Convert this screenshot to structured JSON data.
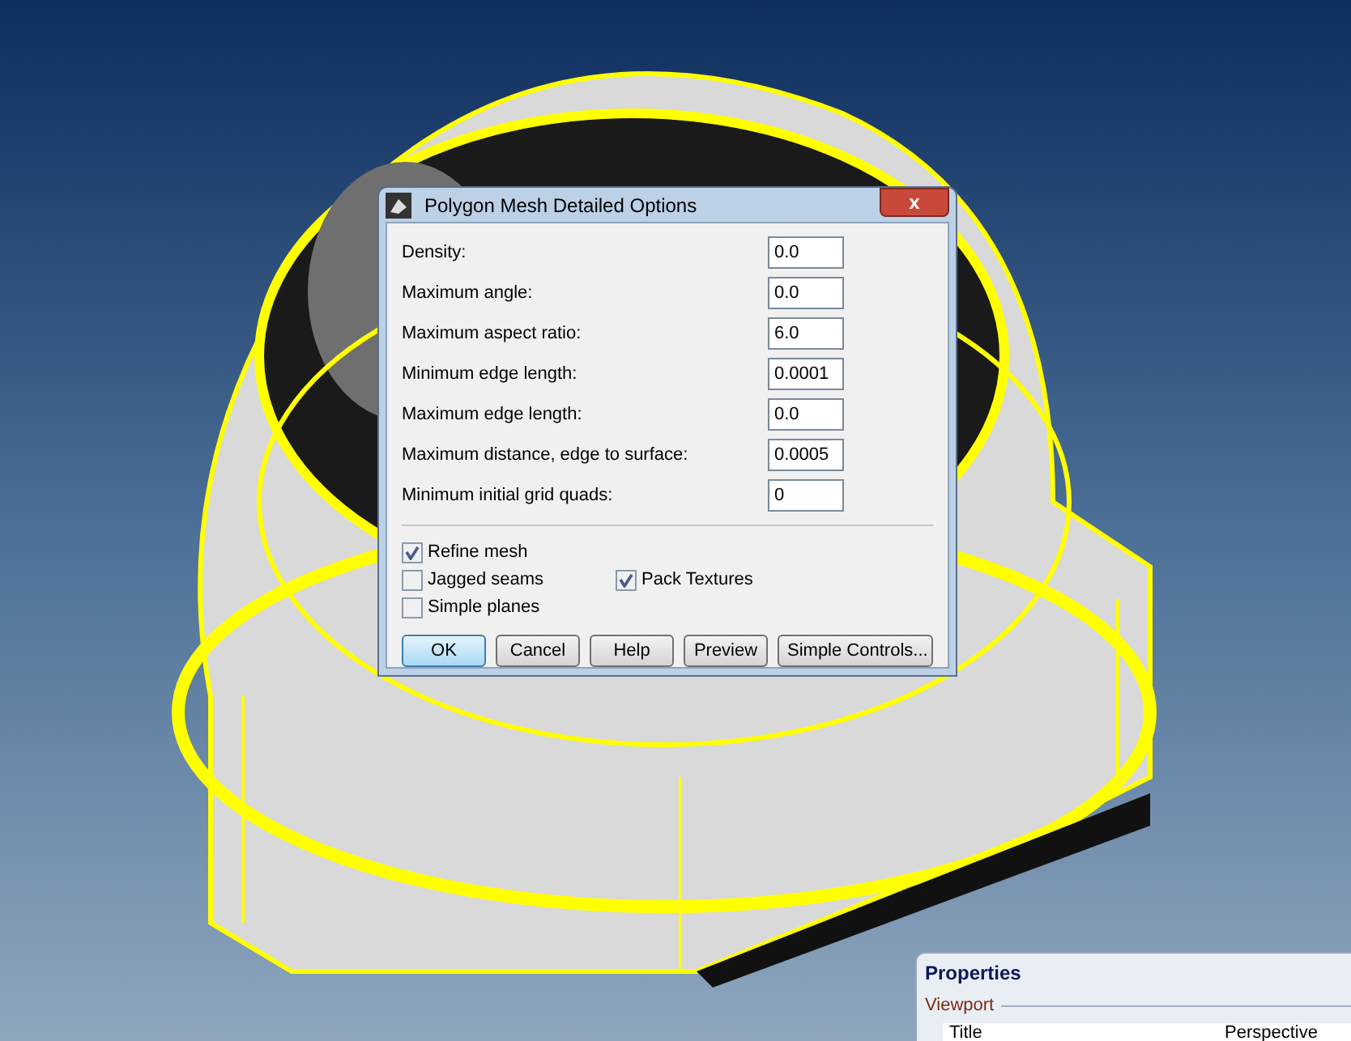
{
  "dialog": {
    "title": "Polygon Mesh Detailed Options",
    "close": "x",
    "fields": [
      {
        "label": "Density:",
        "value": "0.0"
      },
      {
        "label": "Maximum angle:",
        "value": "0.0"
      },
      {
        "label": "Maximum aspect ratio:",
        "value": "6.0"
      },
      {
        "label": "Minimum edge length:",
        "value": "0.0001"
      },
      {
        "label": "Maximum edge length:",
        "value": "0.0"
      },
      {
        "label": "Maximum distance, edge to surface:",
        "value": "0.0005"
      },
      {
        "label": "Minimum initial grid quads:",
        "value": "0"
      }
    ],
    "checkbox_rows": [
      [
        {
          "label": "Refine mesh",
          "checked": true
        }
      ],
      [
        {
          "label": "Jagged seams",
          "checked": false
        },
        {
          "label": "Pack Textures",
          "checked": true
        }
      ],
      [
        {
          "label": "Simple planes",
          "checked": false
        }
      ]
    ],
    "buttons": [
      {
        "label": "OK",
        "default": true
      },
      {
        "label": "Cancel",
        "default": false
      },
      {
        "label": "Help",
        "default": false
      },
      {
        "label": "Preview",
        "default": false
      },
      {
        "label": "Simple Controls...",
        "default": false
      }
    ]
  },
  "properties_panel": {
    "title": "Properties",
    "section": "Viewport",
    "rows": [
      {
        "name": "Title",
        "value": "Perspective"
      }
    ]
  }
}
